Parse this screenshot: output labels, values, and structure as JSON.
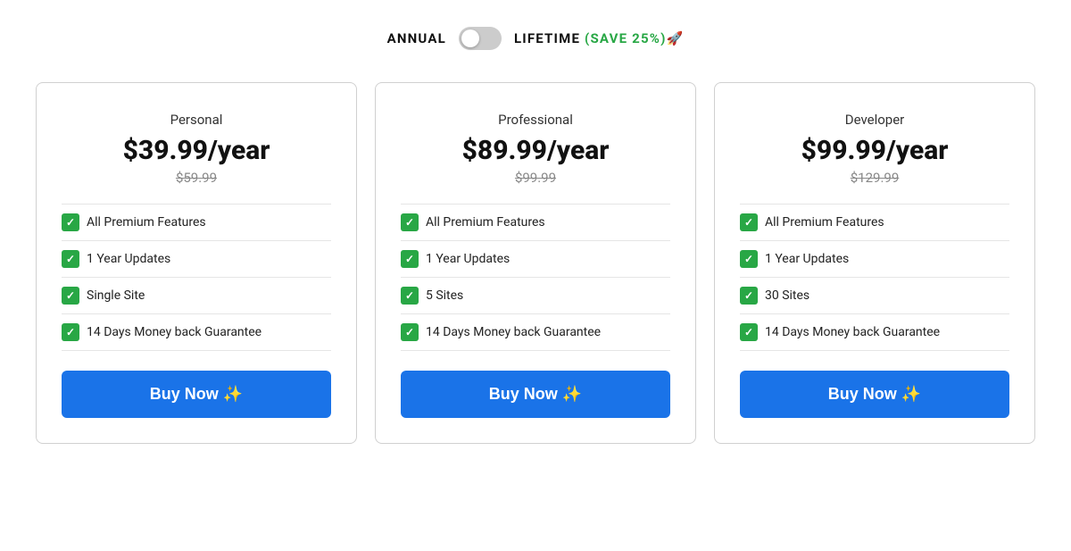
{
  "billing": {
    "annual_label": "ANNUAL",
    "lifetime_label": "LIFETIME",
    "save_badge": "(SAVE 25%)🚀"
  },
  "plans": [
    {
      "name": "Personal",
      "price": "$39.99/year",
      "original_price": "$59.99",
      "features": [
        "All Premium Features",
        "1 Year Updates",
        "Single Site",
        "14 Days Money back Guarantee"
      ],
      "buy_label": "Buy Now ✨"
    },
    {
      "name": "Professional",
      "price": "$89.99/year",
      "original_price": "$99.99",
      "features": [
        "All Premium Features",
        "1 Year Updates",
        "5 Sites",
        "14 Days Money back Guarantee"
      ],
      "buy_label": "Buy Now ✨"
    },
    {
      "name": "Developer",
      "price": "$99.99/year",
      "original_price": "$129.99",
      "features": [
        "All Premium Features",
        "1 Year Updates",
        "30 Sites",
        "14 Days Money back Guarantee"
      ],
      "buy_label": "Buy Now ✨"
    }
  ]
}
